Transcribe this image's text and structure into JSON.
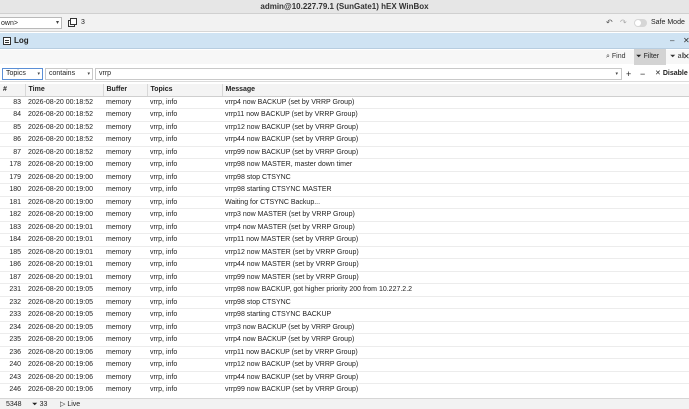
{
  "window": {
    "title": "admin@10.227.79.1 (SunGate1) hEX WinBox"
  },
  "toolbar": {
    "session_value": "own>",
    "windows_count": "3",
    "safe_mode_label": "Safe Mode"
  },
  "panel": {
    "title": "Log",
    "find_label": "Find",
    "filter_label": "Filter",
    "all_label": "all"
  },
  "filter": {
    "field": "Topics",
    "operator": "contains",
    "value": "vrrp",
    "add_label": "+",
    "remove_label": "−",
    "disable_label": "Disable"
  },
  "table": {
    "columns": [
      "#",
      "Time",
      "Buffer",
      "Topics",
      "Message"
    ],
    "rows": [
      [
        "83",
        "2026-08-20 00:18:52",
        "memory",
        "vrrp, info",
        "vrrp4 now BACKUP (set by VRRP Group)"
      ],
      [
        "84",
        "2026-08-20 00:18:52",
        "memory",
        "vrrp, info",
        "vrrp11 now BACKUP (set by VRRP Group)"
      ],
      [
        "85",
        "2026-08-20 00:18:52",
        "memory",
        "vrrp, info",
        "vrrp12 now BACKUP (set by VRRP Group)"
      ],
      [
        "86",
        "2026-08-20 00:18:52",
        "memory",
        "vrrp, info",
        "vrrp44 now BACKUP (set by VRRP Group)"
      ],
      [
        "87",
        "2026-08-20 00:18:52",
        "memory",
        "vrrp, info",
        "vrrp99 now BACKUP (set by VRRP Group)"
      ],
      [
        "178",
        "2026-08-20 00:19:00",
        "memory",
        "vrrp, info",
        "vrrp98 now MASTER, master down timer"
      ],
      [
        "179",
        "2026-08-20 00:19:00",
        "memory",
        "vrrp, info",
        "vrrp98 stop CTSYNC"
      ],
      [
        "180",
        "2026-08-20 00:19:00",
        "memory",
        "vrrp, info",
        "vrrp98 starting CTSYNC MASTER"
      ],
      [
        "181",
        "2026-08-20 00:19:00",
        "memory",
        "vrrp, info",
        "Waiting for CTSYNC Backup..."
      ],
      [
        "182",
        "2026-08-20 00:19:00",
        "memory",
        "vrrp, info",
        "vrrp3 now MASTER (set by VRRP Group)"
      ],
      [
        "183",
        "2026-08-20 00:19:01",
        "memory",
        "vrrp, info",
        "vrrp4 now MASTER (set by VRRP Group)"
      ],
      [
        "184",
        "2026-08-20 00:19:01",
        "memory",
        "vrrp, info",
        "vrrp11 now MASTER (set by VRRP Group)"
      ],
      [
        "185",
        "2026-08-20 00:19:01",
        "memory",
        "vrrp, info",
        "vrrp12 now MASTER (set by VRRP Group)"
      ],
      [
        "186",
        "2026-08-20 00:19:01",
        "memory",
        "vrrp, info",
        "vrrp44 now MASTER (set by VRRP Group)"
      ],
      [
        "187",
        "2026-08-20 00:19:01",
        "memory",
        "vrrp, info",
        "vrrp99 now MASTER (set by VRRP Group)"
      ],
      [
        "231",
        "2026-08-20 00:19:05",
        "memory",
        "vrrp, info",
        "vrrp98 now BACKUP, got higher priority 200 from 10.227.2.2"
      ],
      [
        "232",
        "2026-08-20 00:19:05",
        "memory",
        "vrrp, info",
        "vrrp98 stop CTSYNC"
      ],
      [
        "233",
        "2026-08-20 00:19:05",
        "memory",
        "vrrp, info",
        "vrrp98 starting CTSYNC BACKUP"
      ],
      [
        "234",
        "2026-08-20 00:19:05",
        "memory",
        "vrrp, info",
        "vrrp3 now BACKUP (set by VRRP Group)"
      ],
      [
        "235",
        "2026-08-20 00:19:06",
        "memory",
        "vrrp, info",
        "vrrp4 now BACKUP (set by VRRP Group)"
      ],
      [
        "236",
        "2026-08-20 00:19:06",
        "memory",
        "vrrp, info",
        "vrrp11 now BACKUP (set by VRRP Group)"
      ],
      [
        "240",
        "2026-08-20 00:19:06",
        "memory",
        "vrrp, info",
        "vrrp12 now BACKUP (set by VRRP Group)"
      ],
      [
        "243",
        "2026-08-20 00:19:06",
        "memory",
        "vrrp, info",
        "vrrp44 now BACKUP (set by VRRP Group)"
      ],
      [
        "246",
        "2026-08-20 00:19:06",
        "memory",
        "vrrp, info",
        "vrrp99 now BACKUP (set by VRRP Group)"
      ]
    ]
  },
  "status": {
    "total": "5348",
    "filtered": "33",
    "live_label": "Live"
  },
  "colors": {
    "panel_header": "#cfe3f3",
    "selected_field_border": "#5b8fd6"
  }
}
